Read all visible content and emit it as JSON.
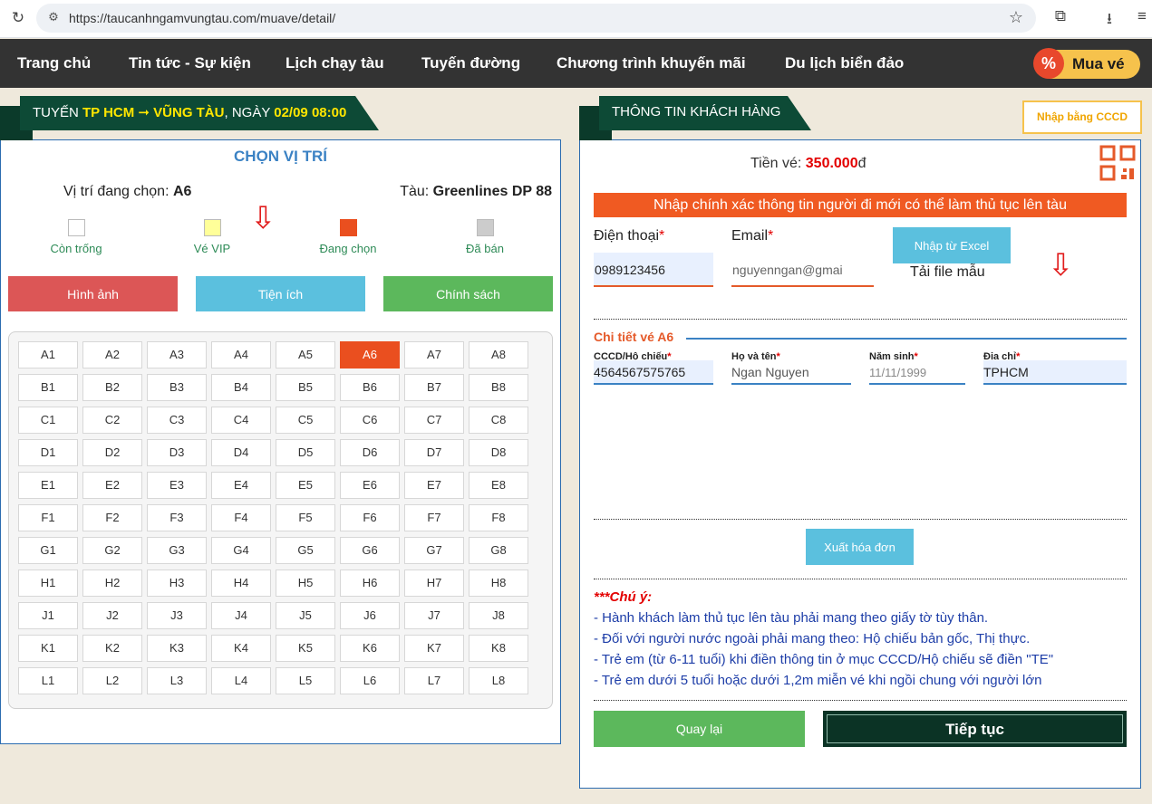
{
  "browser": {
    "url": "https://taucanhngamvungtau.com/muave/detail/"
  },
  "nav": {
    "items": [
      "Trang chủ",
      "Tin tức - Sự kiện",
      "Lịch chạy tàu",
      "Tuyến đường",
      "Chương trình khuyến mãi",
      "Du lịch biển đảo"
    ],
    "buy_label": "Mua vé",
    "buy_badge": "%"
  },
  "route": {
    "prefix": "TUYẾN ",
    "path": "TP HCM ➞ VŨNG TÀU",
    "mid": ", NGÀY ",
    "datetime": "02/09 08:00"
  },
  "seat_panel": {
    "title": "CHỌN VỊ TRÍ",
    "current_label": "Vị trí đang chọn: ",
    "current_value": "A6",
    "ship_label": "Tàu: ",
    "ship_value": "Greenlines DP 88",
    "legend": [
      {
        "label": "Còn trống",
        "color": "#ffffff"
      },
      {
        "label": "Vé VIP",
        "color": "#ffff99"
      },
      {
        "label": "Đang chọn",
        "color": "#ea4f1f"
      },
      {
        "label": "Đã bán",
        "color": "#cccccc"
      }
    ],
    "buttons": {
      "images": "Hình ảnh",
      "amenities": "Tiện ích",
      "policy": "Chính sách"
    },
    "rows": [
      "A",
      "B",
      "C",
      "D",
      "E",
      "F",
      "G",
      "H",
      "J",
      "K",
      "L"
    ],
    "cols": [
      1,
      2,
      3,
      4,
      5,
      6,
      7,
      8
    ],
    "selected_seat": "A6"
  },
  "customer": {
    "title": "THÔNG TIN KHÁCH HÀNG",
    "cccd_button": "Nhập bằng CCCD",
    "price_label": "Tiền vé: ",
    "price_value": "350.000",
    "price_unit": "đ",
    "warning": "Nhập chính xác thông tin người đi mới có thể làm thủ tục lên tàu",
    "phone_label": "Điện thoại",
    "phone_value": "0989123456",
    "email_label": "Email",
    "email_value": "nguyenngan@gmai",
    "excel_button": "Nhập từ Excel",
    "template_link": "Tải file mẫu",
    "detail_title": "Chi tiết vé A6",
    "id_label": "CCCD/Hộ chiếu",
    "id_value": "4564567575765",
    "name_label": "Họ và tên",
    "name_value": "Ngan Nguyen",
    "birth_label": "Năm sinh",
    "birth_value": "11/11/1999",
    "address_label": "Địa chỉ",
    "address_value": "TPHCM",
    "invoice_button": "Xuất hóa đơn",
    "note_prefix": "***",
    "note_title": "Chú ý:",
    "notes": [
      "- Hành khách làm thủ tục lên tàu phải mang theo giấy tờ tùy thân.",
      "- Đối với người nước ngoài phải mang theo: Hộ chiếu bản gốc, Thị thực.",
      "- Trẻ em (từ 6-11 tuổi) khi điền thông tin ở mục CCCD/Hộ chiếu sẽ điền \"TE\"",
      "- Trẻ em dưới 5 tuổi hoặc dưới 1,2m miễn vé khi ngồi chung với người lớn"
    ],
    "back_button": "Quay lại",
    "next_button": "Tiếp tục",
    "required_mark": "*"
  }
}
